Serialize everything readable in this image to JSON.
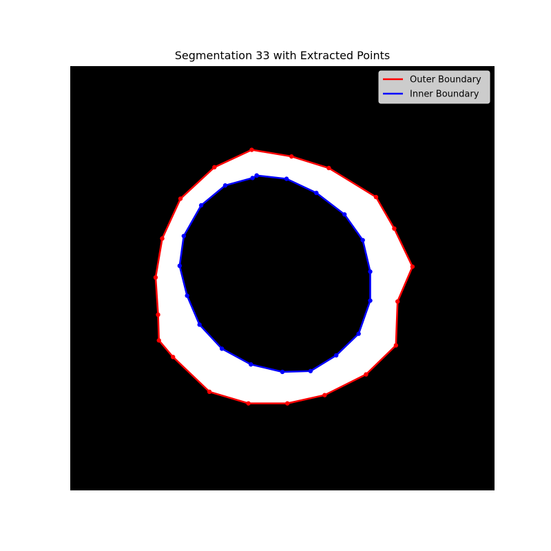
{
  "title": "Segmentation 33 with Extracted Points",
  "chart_data": {
    "type": "scatter",
    "title": "Segmentation 33 with Extracted Points",
    "xlim": [
      0,
      256
    ],
    "ylim": [
      256,
      0
    ],
    "axes_visible": false,
    "grid": false,
    "legend_position": "top-right",
    "background": {
      "image": "binary segmentation mask",
      "background_color": "#000000",
      "mask_color": "#ffffff",
      "ring_fill_between": [
        "outer",
        "inner"
      ]
    },
    "series": [
      {
        "id": "outer",
        "name": "Outer Boundary",
        "color": "#ff0000",
        "closed": true,
        "x": [
          109.5,
          133.5,
          156,
          184.5,
          195.5,
          206.5,
          197.5,
          196.5,
          178.5,
          153.5,
          131,
          107.5,
          84,
          62,
          53.5,
          53,
          51.5,
          55.5,
          66.5,
          87
        ],
        "y": [
          50.5,
          54.5,
          61.5,
          79,
          98,
          121,
          142,
          168.5,
          186,
          198.5,
          203.5,
          203.5,
          196.5,
          175.5,
          165.5,
          150,
          127.5,
          104,
          80,
          61
        ]
      },
      {
        "id": "inner",
        "name": "Inner Boundary",
        "color": "#0000ff",
        "closed": true,
        "x": [
          112.5,
          130.5,
          148.5,
          165.5,
          176.5,
          181,
          181,
          174,
          160.5,
          145,
          128,
          109,
          91.5,
          78,
          70.5,
          66,
          68.5,
          79,
          93.5,
          110,
          112.5
        ],
        "y": [
          66,
          68,
          76.5,
          89.5,
          105,
          124,
          141.5,
          161.5,
          174.5,
          184,
          184.5,
          180,
          170.5,
          156,
          138.5,
          120.5,
          102.5,
          84,
          72,
          67.5,
          66
        ]
      }
    ]
  }
}
